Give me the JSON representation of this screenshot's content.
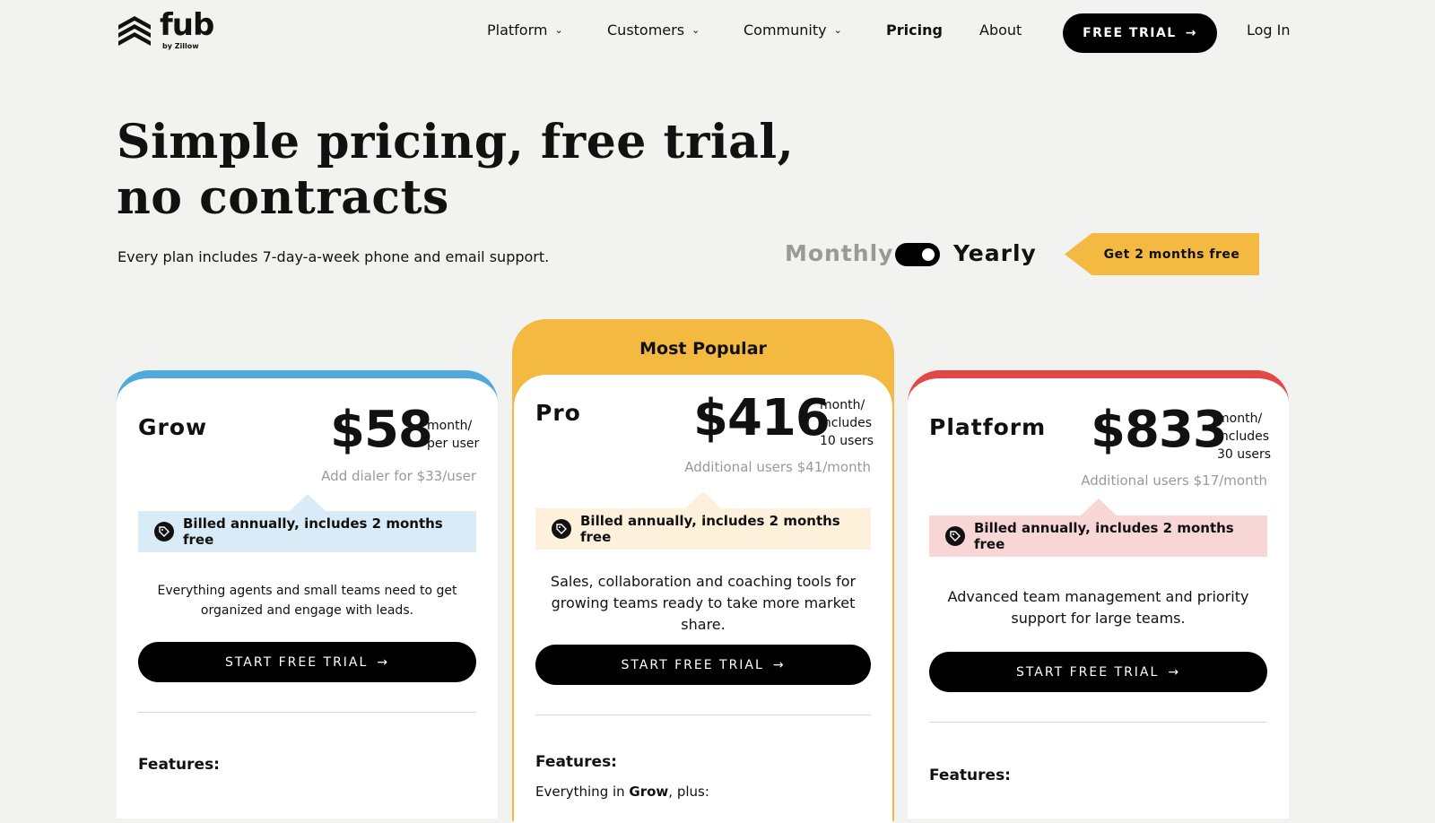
{
  "brand": {
    "name": "fub",
    "sub": "by Zillow"
  },
  "nav": {
    "items": [
      {
        "label": "Platform",
        "has_dropdown": true
      },
      {
        "label": "Customers",
        "has_dropdown": true
      },
      {
        "label": "Community",
        "has_dropdown": true
      },
      {
        "label": "Pricing",
        "has_dropdown": false,
        "active": true
      },
      {
        "label": "About",
        "has_dropdown": false
      }
    ],
    "trial_button": "FREE TRIAL",
    "login": "Log In"
  },
  "hero": {
    "title_line1": "Simple pricing, free trial,",
    "title_line2": "no contracts",
    "subtitle": "Every plan includes 7-day-a-week phone and email support.",
    "toggle_monthly": "Monthly",
    "toggle_yearly": "Yearly",
    "toggle_selected": "Yearly",
    "promo": "Get 2 months free"
  },
  "plans": {
    "grow": {
      "name": "Grow",
      "price": "$58",
      "unit_line1": "month/",
      "unit_line2": "per user",
      "note": "Add dialer for $33/user",
      "billed": "Billed annually, includes 2 months free",
      "description": "Everything agents and small teams need to get organized and engage with leads.",
      "cta": "START FREE TRIAL",
      "features_heading": "Features:",
      "accent_color": "#4fa9dc",
      "billed_bg": "#d8ebf6"
    },
    "pro": {
      "badge": "Most Popular",
      "name": "Pro",
      "price": "$416",
      "unit_line1": "month/",
      "unit_line2": "includes",
      "unit_line3": "10 users",
      "note": "Additional users $41/month",
      "billed": "Billed annually, includes 2 months free",
      "description": "Sales, collaboration and coaching tools for growing teams ready to take more market share.",
      "cta": "START FREE TRIAL",
      "features_heading": "Features:",
      "features_intro_pre": "Everything in ",
      "features_intro_plan": "Grow",
      "features_intro_post": ", plus:",
      "accent_color": "#f3b940",
      "billed_bg": "#fdf1dc"
    },
    "platform": {
      "name": "Platform",
      "price": "$833",
      "unit_line1": "month/",
      "unit_line2": "includes",
      "unit_line3": "30 users",
      "note": "Additional users $17/month",
      "billed": "Billed annually, includes 2 months free",
      "description": "Advanced team management and priority support for large teams.",
      "cta": "START FREE TRIAL",
      "features_heading": "Features:",
      "accent_color": "#e34848",
      "billed_bg": "#f9d6d6"
    }
  }
}
